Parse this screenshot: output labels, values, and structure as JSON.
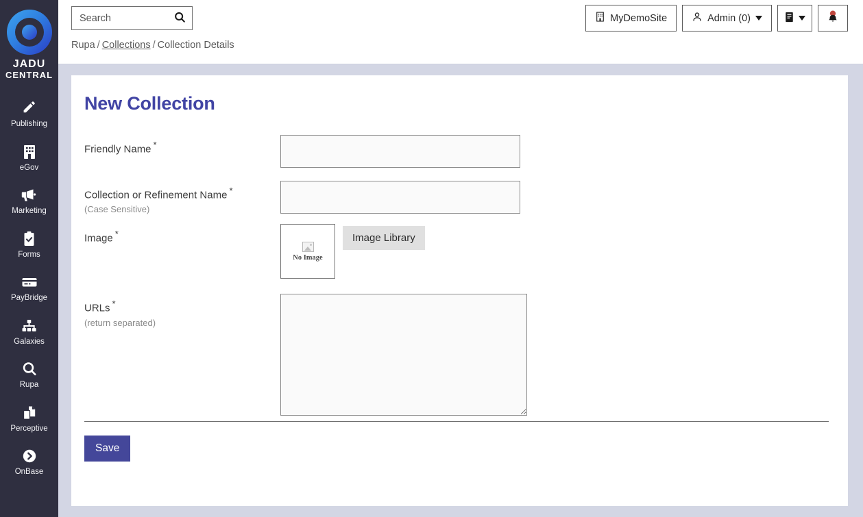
{
  "app": {
    "logo_line1": "JADU",
    "logo_line2": "CENTRAL"
  },
  "sidebar": {
    "items": [
      {
        "label": "Publishing",
        "icon": "pencil-icon"
      },
      {
        "label": "eGov",
        "icon": "building-icon"
      },
      {
        "label": "Marketing",
        "icon": "megaphone-icon"
      },
      {
        "label": "Forms",
        "icon": "clipboard-check-icon"
      },
      {
        "label": "PayBridge",
        "icon": "credit-card-icon"
      },
      {
        "label": "Galaxies",
        "icon": "sitemap-icon"
      },
      {
        "label": "Rupa",
        "icon": "magnifier-icon"
      },
      {
        "label": "Perceptive",
        "icon": "documents-icon"
      },
      {
        "label": "OnBase",
        "icon": "chevron-circle-right-icon"
      }
    ]
  },
  "topbar": {
    "search": {
      "placeholder": "Search",
      "value": "",
      "button_icon": "search-icon"
    },
    "breadcrumb": {
      "root": "Rupa",
      "sep": "/",
      "link": "Collections",
      "current": "Collection Details"
    },
    "buttons": {
      "site": {
        "label": "MyDemoSite",
        "icon": "building-icon"
      },
      "user": {
        "label": "Admin (0)",
        "icon": "user-icon",
        "caret": true
      },
      "book": {
        "label": "",
        "icon": "book-icon",
        "caret": true
      },
      "bell": {
        "label": "",
        "icon": "bell-icon",
        "has_badge": true,
        "badge_color": "#c0483f"
      }
    }
  },
  "main": {
    "title": "New Collection",
    "fields": {
      "friendly_name": {
        "label": "Friendly Name",
        "required": "*",
        "value": "",
        "placeholder": ""
      },
      "collection_name": {
        "label": "Collection or Refinement Name",
        "required": "*",
        "hint": "(Case Sensitive)",
        "value": "",
        "placeholder": ""
      },
      "image": {
        "label": "Image",
        "required": "*",
        "thumb_caption": "No Image",
        "library_button": "Image Library"
      },
      "urls": {
        "label": "URLs",
        "required": "*",
        "hint": "(return separated)",
        "value": "",
        "placeholder": ""
      }
    },
    "save_label": "Save"
  },
  "colors": {
    "accent": "#4144a4",
    "save_button": "#44479a",
    "sidebar_bg": "#2f2f40",
    "page_bg": "#d3d6e4",
    "notification_badge": "#c0483f"
  }
}
